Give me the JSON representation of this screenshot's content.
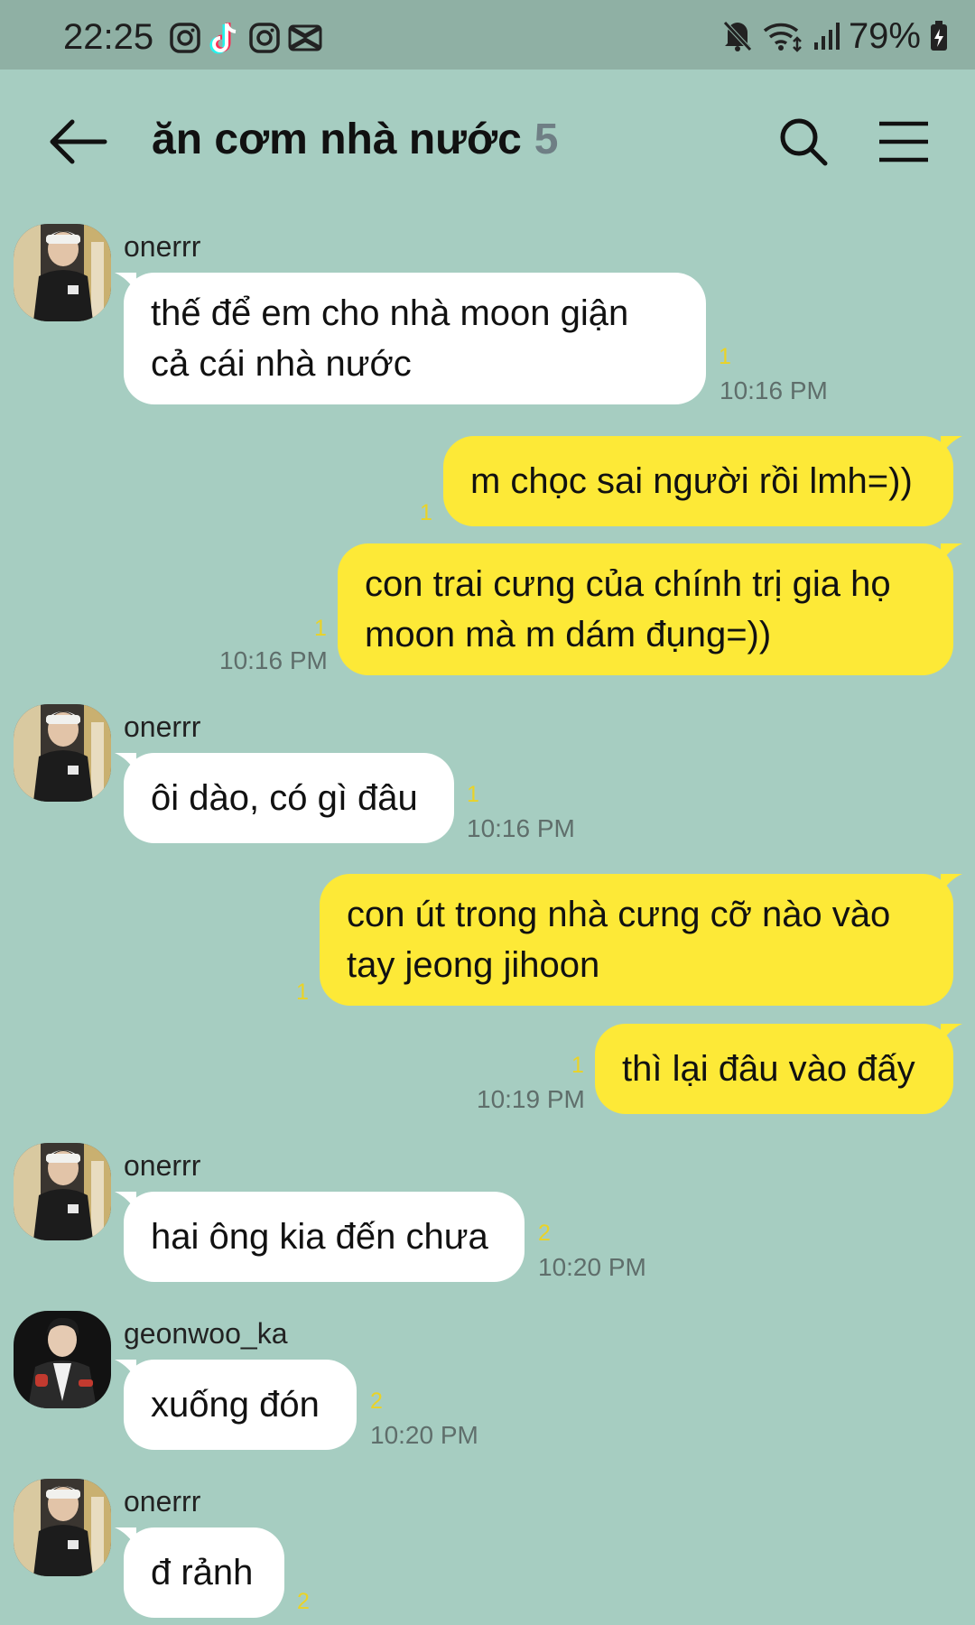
{
  "status_bar": {
    "time": "22:25",
    "battery": "79%",
    "left_icons": [
      "instagram-icon",
      "tiktok-icon",
      "instagram-icon",
      "capcut-icon"
    ],
    "right_icons": [
      "mute-icon",
      "wifi-icon",
      "signal-icon",
      "battery-charging-icon"
    ]
  },
  "header": {
    "title": "ăn cơm nhà nước",
    "member_count": "5"
  },
  "messages": [
    {
      "side": "in",
      "sender": "onerrr",
      "text": "thế để em cho nhà moon giận\ncả cái nhà nước",
      "unread": "1",
      "time": "10:16 PM"
    },
    {
      "side": "out",
      "text": "m chọc sai người rồi lmh=))",
      "unread": "1",
      "time": ""
    },
    {
      "side": "out",
      "text": "con trai cưng của chính trị gia họ\nmoon mà m dám đụng=))",
      "unread": "1",
      "time": "10:16 PM"
    },
    {
      "side": "in",
      "sender": "onerrr",
      "text": "ôi dào, có gì đâu",
      "unread": "1",
      "time": "10:16 PM"
    },
    {
      "side": "out",
      "text": "con út trong nhà cưng cỡ nào vào\ntay jeong jihoon",
      "unread": "1",
      "time": ""
    },
    {
      "side": "out",
      "text": "thì lại đâu vào đấy",
      "unread": "1",
      "time": "10:19 PM"
    },
    {
      "side": "in",
      "sender": "onerrr",
      "text": "hai ông kia đến chưa",
      "unread": "2",
      "time": "10:20 PM"
    },
    {
      "side": "in",
      "sender": "geonwoo_ka",
      "text": "xuống đón",
      "unread": "2",
      "time": "10:20 PM"
    },
    {
      "side": "in",
      "sender": "onerrr",
      "text": "đ rảnh",
      "unread": "2",
      "time": ""
    }
  ],
  "colors": {
    "background": "#a6cdc1",
    "status_bar": "#8fb0a4",
    "outgoing_bubble": "#fde937",
    "incoming_bubble": "#ffffff",
    "unread_count": "#ead327"
  }
}
